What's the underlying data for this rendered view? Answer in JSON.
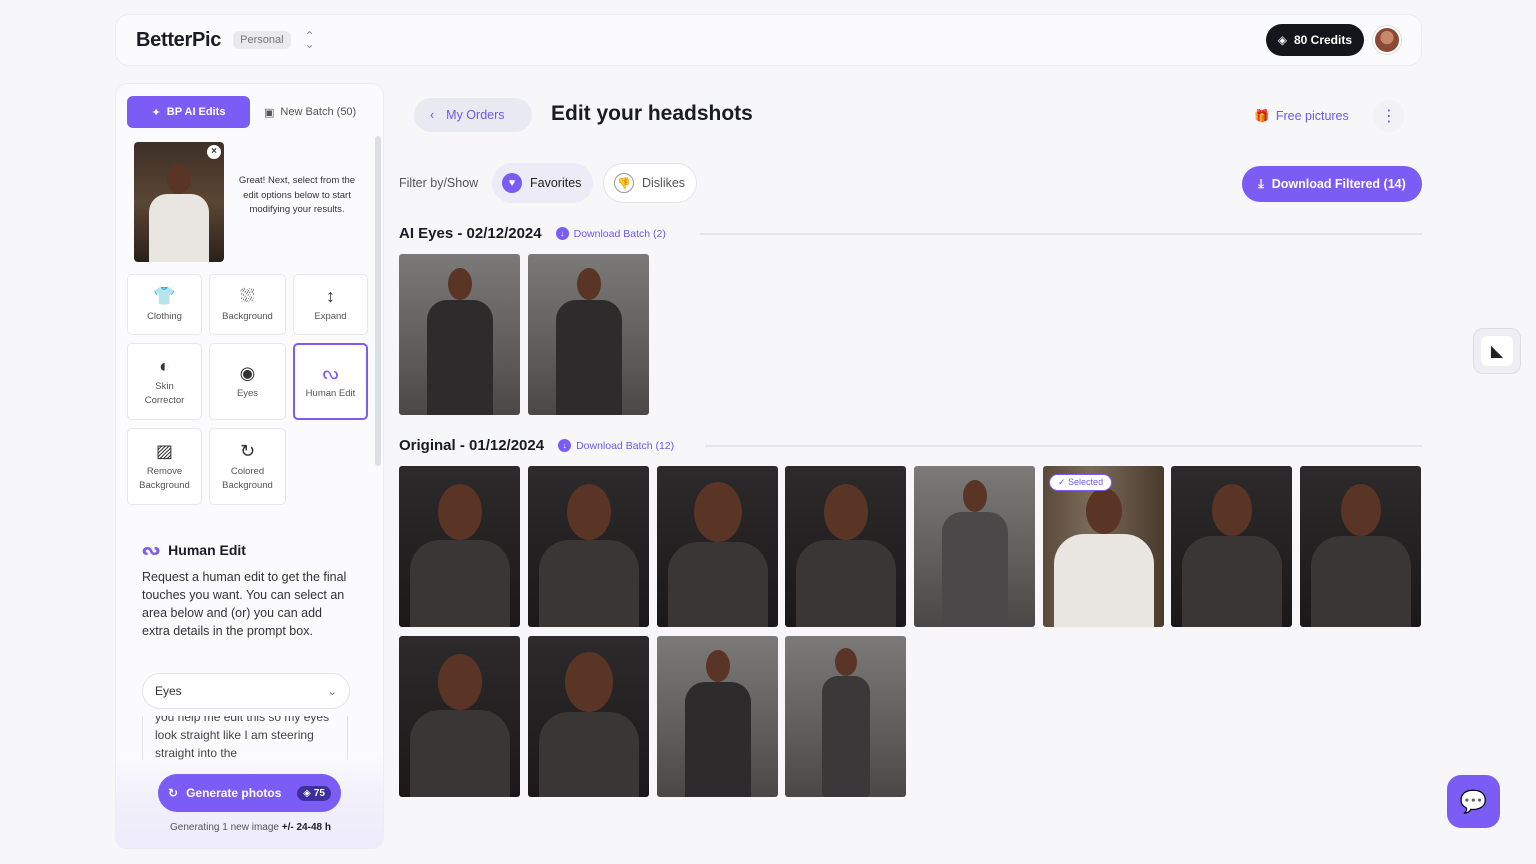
{
  "header": {
    "logo": "BetterPic",
    "account_badge": "Personal",
    "credits": "80 Credits"
  },
  "sidebar": {
    "tab_active": "BP AI Edits",
    "tab_inactive": "New Batch (50)",
    "hint": "Great! Next, select from the edit options below to start modifying your results.",
    "tools": [
      {
        "label": "Clothing",
        "icon": "shirt-icon"
      },
      {
        "label": "Background",
        "icon": "background-icon"
      },
      {
        "label": "Expand",
        "icon": "expand-icon"
      },
      {
        "label": "Skin Corrector",
        "icon": "contrast-icon"
      },
      {
        "label": "Eyes",
        "icon": "eye-icon"
      },
      {
        "label": "Human Edit",
        "icon": "human-edit-icon"
      },
      {
        "label": "Remove Background",
        "icon": "remove-background-icon"
      },
      {
        "label": "Colored Background",
        "icon": "colored-background-icon"
      }
    ],
    "human_edit": {
      "title": "Human Edit",
      "description": "Request a human edit to get the final touches you want. You can select an area below and (or) you can add extra details in the prompt box.",
      "area_select": "Eyes",
      "prompt_text": "you help me edit this so my eyes look straight like I am steering straight into the"
    },
    "generate": {
      "label": "Generate photos",
      "cost": "75",
      "note_prefix": "Generating 1 new image",
      "note_time": "+/- 24-48 h"
    }
  },
  "main": {
    "back_label": "My Orders",
    "title": "Edit your headshots",
    "free_pictures": "Free pictures",
    "filter_label": "Filter by/Show",
    "filter_favorites": "Favorites",
    "filter_dislikes": "Dislikes",
    "download_filtered": "Download Filtered (14)",
    "sections": [
      {
        "title": "AI Eyes - 02/12/2024",
        "download": "Download Batch (2)"
      },
      {
        "title": "Original - 01/12/2024",
        "download": "Download Batch (12)"
      }
    ],
    "selected_tag": "Selected"
  },
  "colors": {
    "accent": "#7b5cf5",
    "dark": "#15151c"
  }
}
